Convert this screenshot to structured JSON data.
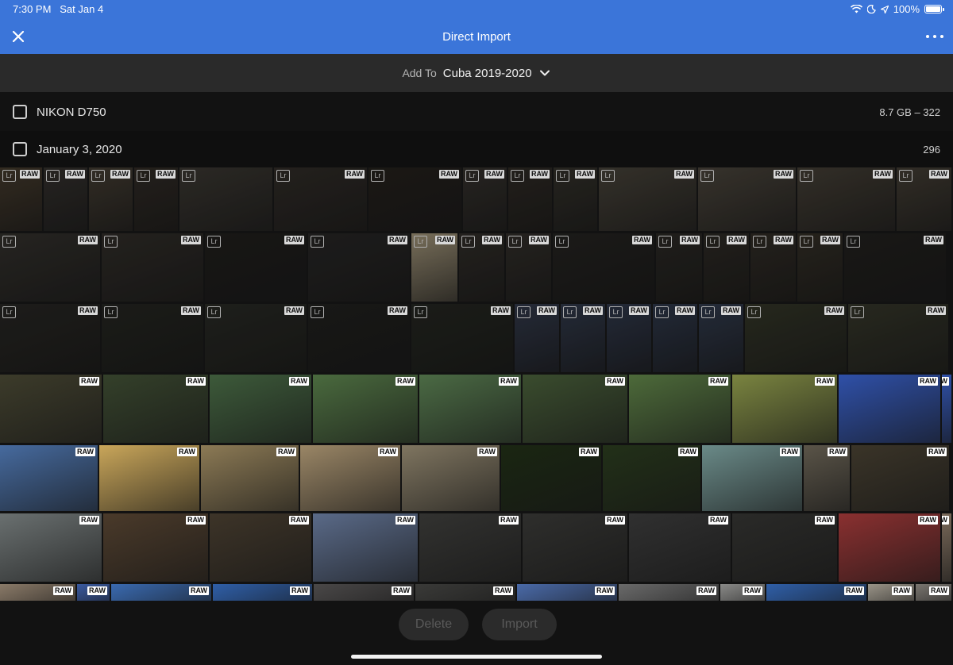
{
  "status_bar": {
    "time": "7:30 PM",
    "date": "Sat Jan 4",
    "battery": "100%",
    "icons": [
      "wifi-icon",
      "moon-icon",
      "location-icon",
      "battery-icon"
    ]
  },
  "header": {
    "title": "Direct Import",
    "close_icon": "close-icon",
    "more_icon": "more-icon"
  },
  "add_to": {
    "label": "Add To",
    "value": "Cuba 2019-2020"
  },
  "source": {
    "name": "NIKON D750",
    "info": "8.7 GB – 322"
  },
  "date_group": {
    "label": "January 3, 2020",
    "count": "296"
  },
  "badges": {
    "raw": "RAW",
    "lr": "Lr"
  },
  "actions": {
    "delete_label": "Delete",
    "import_label": "Import"
  },
  "colors": {
    "accent": "#3b75d9",
    "bar_bg": "#2a2a2a",
    "background": "#121212"
  }
}
